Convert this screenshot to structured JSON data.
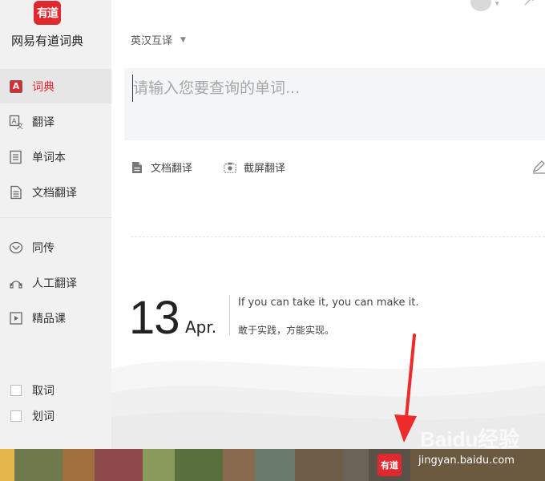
{
  "app": {
    "name": "网易有道词典",
    "logo_text": "有道"
  },
  "sidebar": {
    "items": [
      {
        "label": "词典",
        "icon": "dictionary-icon",
        "active": true
      },
      {
        "label": "翻译",
        "icon": "translate-icon"
      },
      {
        "label": "单词本",
        "icon": "wordbook-icon"
      },
      {
        "label": "文档翻译",
        "icon": "document-icon"
      },
      {
        "label": "同传",
        "icon": "simultaneous-icon"
      },
      {
        "label": "人工翻译",
        "icon": "human-translate-icon"
      },
      {
        "label": "精品课",
        "icon": "course-icon"
      }
    ],
    "checks": [
      {
        "label": "取词",
        "checked": false
      },
      {
        "label": "划词",
        "checked": false
      }
    ]
  },
  "main": {
    "lang_select": "英汉互译",
    "search": {
      "placeholder": "请输入您要查询的单词...",
      "value": ""
    },
    "tools": [
      {
        "label": "文档翻译",
        "icon": "document-translate-icon"
      },
      {
        "label": "截屏翻译",
        "icon": "screenshot-icon"
      }
    ],
    "daily": {
      "day": "13",
      "month": "Apr.",
      "quote_en": "If you can take it, you can make it.",
      "quote_cn": "敢于实践，方能实现。"
    }
  },
  "taskbar": {
    "app_label": "有道"
  },
  "watermark": {
    "logo": "Baidu经验",
    "url": "jingyan.baidu.com"
  },
  "colors": {
    "brand": "#e0282f",
    "sidebar_bg": "#f1f1f1",
    "search_bg": "#f4f5f6",
    "taskbar": "#6b5a3f"
  }
}
